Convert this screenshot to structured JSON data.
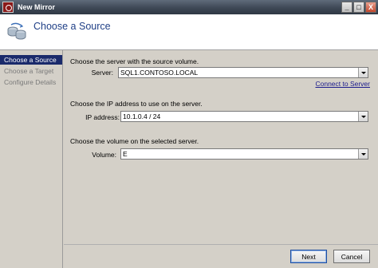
{
  "window": {
    "title": "New Mirror",
    "controls": {
      "minimize": "_",
      "restore": "□",
      "close": "X"
    }
  },
  "header": {
    "title": "Choose a Source",
    "icon": "mirror-disks-icon"
  },
  "nav": {
    "items": [
      {
        "label": "Choose a Source",
        "active": true
      },
      {
        "label": "Choose a Target",
        "active": false
      },
      {
        "label": "Configure Details",
        "active": false
      }
    ]
  },
  "server_section": {
    "prompt": "Choose the server with the source volume.",
    "label": "Server:",
    "value": "SQL1.CONTOSO.LOCAL",
    "link": "Connect to Server"
  },
  "ip_section": {
    "prompt": "Choose the IP address to use on the server.",
    "label": "IP address:",
    "value": "10.1.0.4 / 24"
  },
  "volume_section": {
    "prompt": "Choose the volume on the selected server.",
    "label": "Volume:",
    "value": "E"
  },
  "footer": {
    "next": "Next",
    "cancel": "Cancel"
  }
}
